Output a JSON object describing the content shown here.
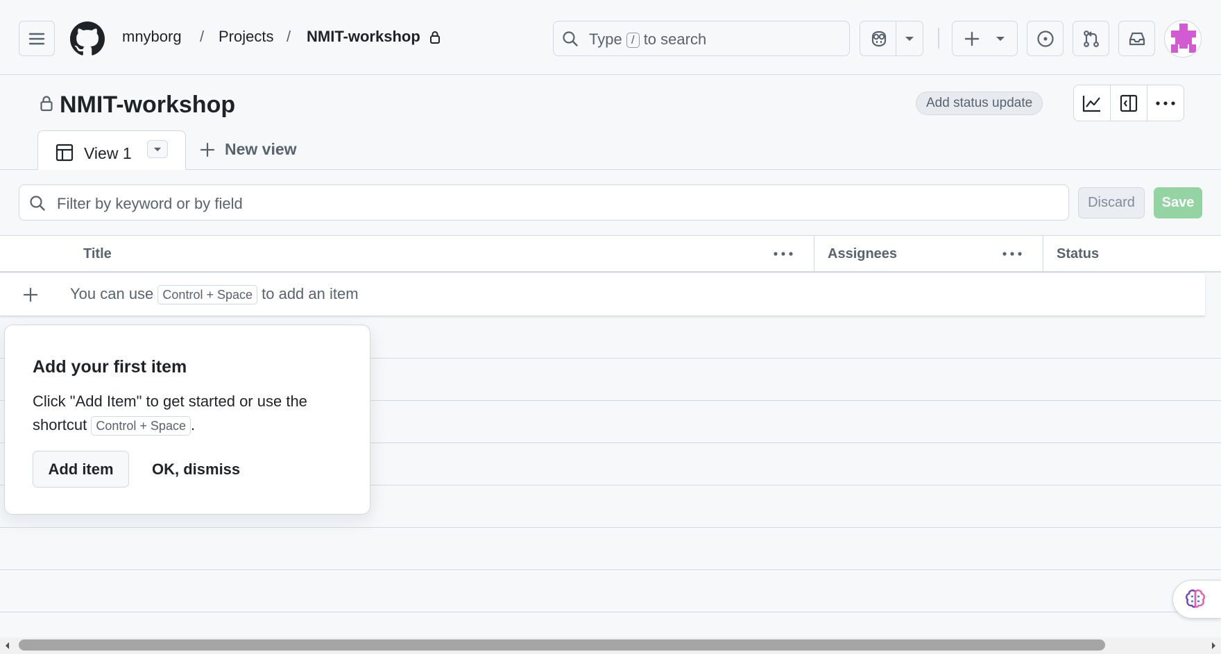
{
  "header": {
    "breadcrumb": [
      "mnyborg",
      "Projects",
      "NMIT-workshop"
    ],
    "separator": "/",
    "search": {
      "prefix": "Type",
      "key": "/",
      "suffix": "to search"
    }
  },
  "project": {
    "title": "NMIT-workshop",
    "status_update_label": "Add status update"
  },
  "tabs": {
    "view1_label": "View 1",
    "new_view_label": "New view"
  },
  "filter": {
    "placeholder": "Filter by keyword or by field",
    "discard_label": "Discard",
    "save_label": "Save"
  },
  "table": {
    "columns": [
      "Title",
      "Assignees",
      "Status"
    ],
    "add_row": {
      "prefix": "You can use",
      "shortcut": "Control + Space",
      "suffix": "to add an item"
    }
  },
  "popover": {
    "title": "Add your first item",
    "body_line1": "Click \"Add Item\" to get started or use the",
    "body_line2_prefix": "shortcut",
    "shortcut": "Control + Space",
    "body_line2_suffix": ".",
    "add_item_label": "Add item",
    "dismiss_label": "OK, dismiss"
  },
  "colors": {
    "save_disabled": "#94d3a2",
    "avatar": "#d25bd1",
    "copilot_brain_a": "#6f42c1",
    "copilot_brain_b": "#e85aad"
  }
}
